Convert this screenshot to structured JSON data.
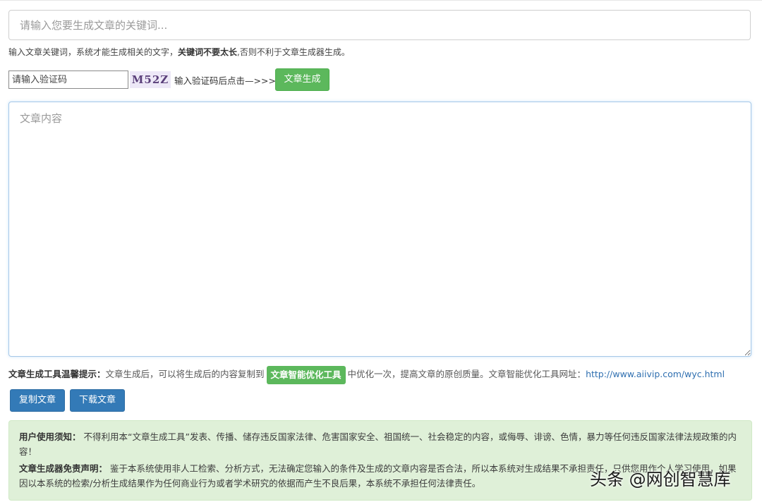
{
  "keyword": {
    "placeholder": "请输入您要生成文章的关键词...",
    "hint_prefix": "输入文章关键词，系统才能生成相关的文字，",
    "hint_bold": "关键词不要太长",
    "hint_suffix": ",否则不利于文章生成器生成。"
  },
  "captcha": {
    "placeholder": "请输入验证码",
    "code": "M52Z",
    "hint": "输入验证码后点击—>>>",
    "generate_label": "文章生成"
  },
  "content": {
    "placeholder": "文章内容"
  },
  "tip": {
    "title": "文章生成工具温馨提示：",
    "text1": "文章生成后，可以将生成后的内容复制到",
    "badge": "文章智能优化工具",
    "text2": "中优化一次，提高文章的原创质量。文章智能优化工具网址：",
    "url": "http://www.aiivip.com/wyc.html"
  },
  "actions": {
    "copy_label": "复制文章",
    "download_label": "下载文章"
  },
  "notice": {
    "usage_title": "用户使用须知：",
    "usage_text": "不得利用本“文章生成工具”发表、传播、储存违反国家法律、危害国家安全、祖国统一、社会稳定的内容，或侮辱、诽谤、色情，暴力等任何违反国家法律法规政策的内容！",
    "disclaimer_title": "文章生成器免责声明：",
    "disclaimer_text": "鉴于本系统使用非人工检索、分析方式，无法确定您输入的条件及生成的文章内容是否合法，所以本系统对生成结果不承担责任，只供您用作个人学习使用，如果因以本系统的检索/分析生成结果作为任何商业行为或者学术研究的依据而产生不良后果，本系统不承担任何法律责任。"
  },
  "watermark": "头条 @网创智慧库"
}
